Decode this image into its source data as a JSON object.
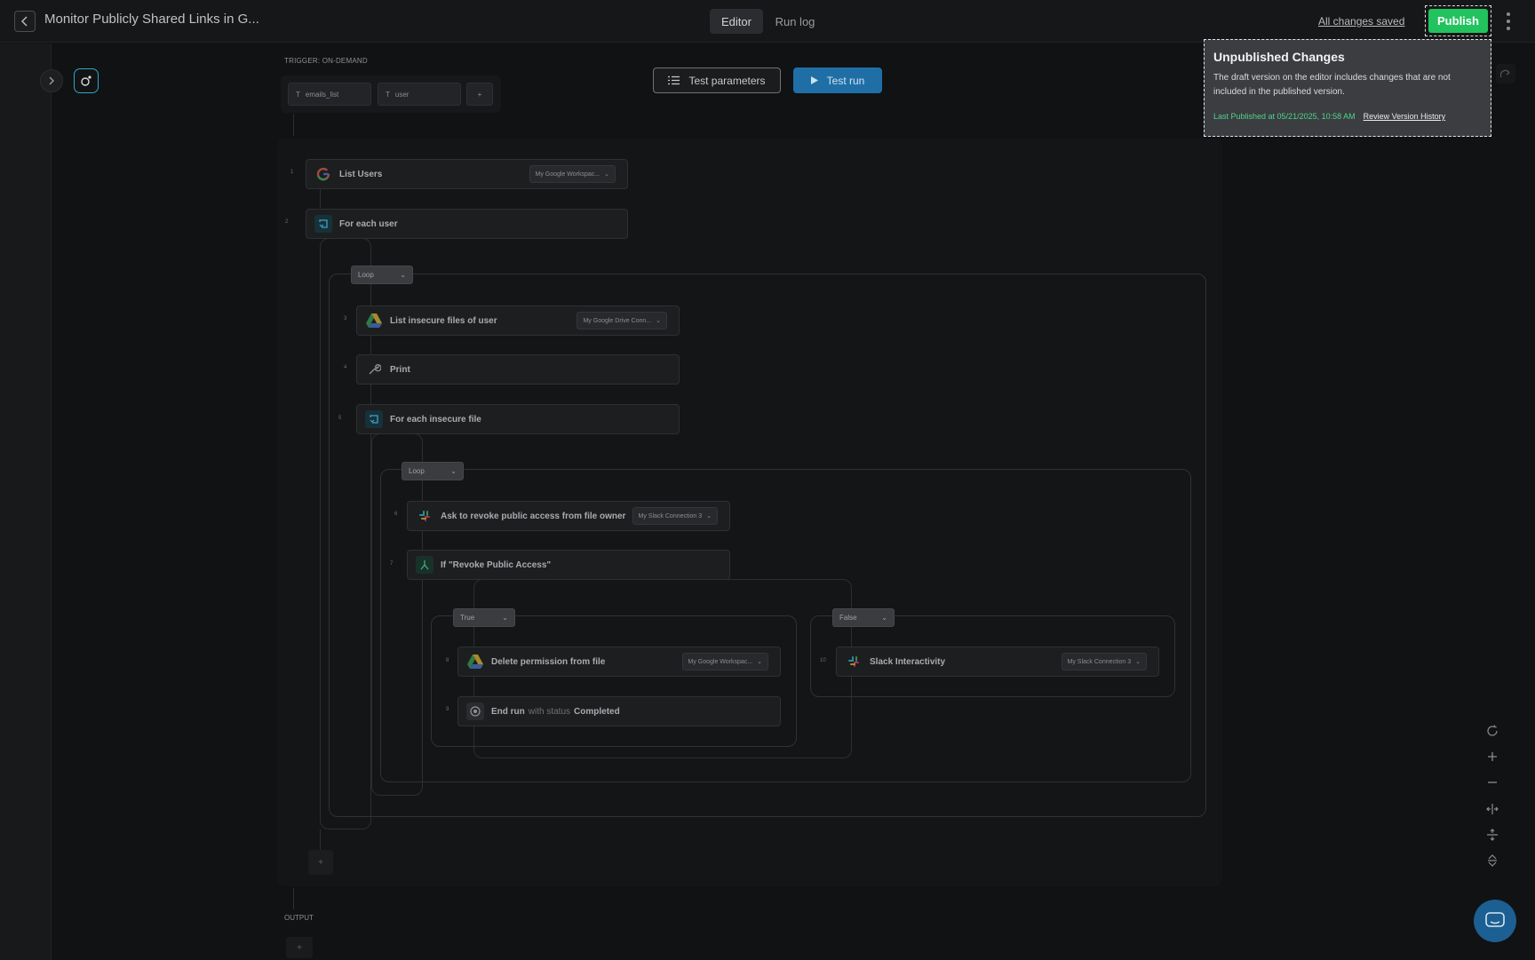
{
  "header": {
    "title": "Monitor Publicly Shared Links in G...",
    "tabs": [
      {
        "label": "Editor",
        "active": true
      },
      {
        "label": "Run log",
        "active": false
      }
    ],
    "save_status": "All changes saved",
    "publish_label": "Publish"
  },
  "trigger": {
    "label": "TRIGGER: ON-DEMAND",
    "params": [
      "emails_list",
      "user"
    ],
    "add_label": "+"
  },
  "toolbar": {
    "test_parameters": "Test parameters",
    "test_run": "Test run"
  },
  "steps": [
    {
      "num": "1",
      "label": "List Users",
      "connection": "My Google Workspac...",
      "icon": "google-icon"
    },
    {
      "num": "2",
      "label": "For each user",
      "icon": "loop-icon"
    },
    {
      "num": "3",
      "label": "List insecure files of user",
      "connection": "My Google Drive Conn...",
      "icon": "google-drive-icon"
    },
    {
      "num": "4",
      "label": "Print",
      "icon": "wrench-icon"
    },
    {
      "num": "5",
      "label": "For each insecure file",
      "icon": "loop-icon"
    },
    {
      "num": "6",
      "label": "Ask to revoke public access from file owner",
      "connection": "My Slack Connection 3",
      "icon": "slack-icon"
    },
    {
      "num": "7",
      "label": "If \"Revoke Public Access\"",
      "icon": "branch-icon"
    },
    {
      "num": "8",
      "label": "Delete permission from file",
      "connection": "My Google Workspac...",
      "icon": "google-drive-icon"
    },
    {
      "num": "9",
      "label": "End run",
      "status_prefix": "with status",
      "status": "Completed",
      "icon": "stop-icon"
    },
    {
      "num": "10",
      "label": "Slack Interactivity",
      "connection": "My Slack Connection 3",
      "icon": "slack-icon"
    }
  ],
  "branches": {
    "loop_outer": "Loop",
    "loop_inner": "Loop",
    "true_label": "True",
    "false_label": "False"
  },
  "add_step_label": "+",
  "output": {
    "label": "OUTPUT",
    "add_label": "+"
  },
  "popover": {
    "title": "Unpublished Changes",
    "description": "The draft version on the editor includes changes that are not included in the published version.",
    "last_published": "Last Published at 05/21/2025, 10:58 AM",
    "review_link": "Review Version History"
  },
  "colors": {
    "publish": "#22c35e",
    "test_run": "#1f6fa6",
    "last_published_text": "#4ed48a"
  }
}
